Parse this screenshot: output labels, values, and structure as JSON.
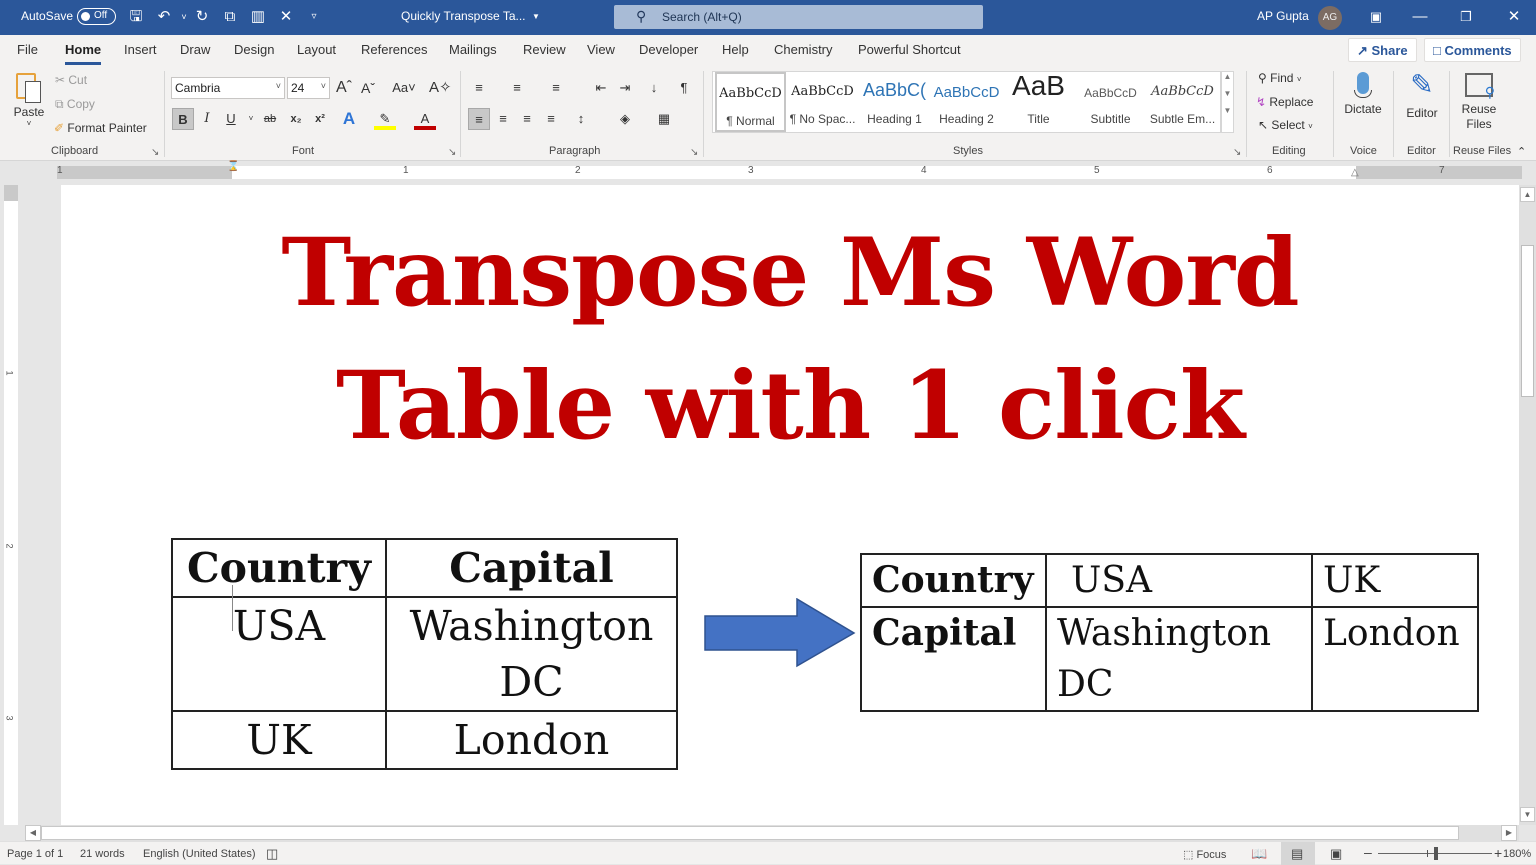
{
  "titlebar": {
    "autosave_label": "AutoSave",
    "autosave_state": "Off",
    "doc_title": "Quickly Transpose Ta...",
    "search_placeholder": "Search (Alt+Q)",
    "user_name": "AP Gupta",
    "user_initials": "AG",
    "quick_access": [
      "save-icon",
      "undo-icon",
      "redo-icon",
      "copy-format-icon",
      "org-chart-icon",
      "close-x-icon",
      "customize-icon"
    ]
  },
  "tabs": [
    "File",
    "Home",
    "Insert",
    "Draw",
    "Design",
    "Layout",
    "References",
    "Mailings",
    "Review",
    "View",
    "Developer",
    "Help",
    "Chemistry",
    "Powerful Shortcut"
  ],
  "active_tab": "Home",
  "header_buttons": {
    "share": "Share",
    "comments": "Comments"
  },
  "ribbon": {
    "clipboard": {
      "label": "Clipboard",
      "paste": "Paste",
      "cut": "Cut",
      "copy": "Copy",
      "format_painter": "Format Painter"
    },
    "font": {
      "label": "Font",
      "font_name": "Cambria",
      "font_size": "24"
    },
    "paragraph": {
      "label": "Paragraph"
    },
    "styles": {
      "label": "Styles",
      "items": [
        {
          "preview": "AaBbCcD",
          "name": "¶ Normal"
        },
        {
          "preview": "AaBbCcD",
          "name": "¶ No Spac..."
        },
        {
          "preview": "AaBbC(",
          "name": "Heading 1"
        },
        {
          "preview": "AaBbCcD",
          "name": "Heading 2"
        },
        {
          "preview": "AaB",
          "name": "Title"
        },
        {
          "preview": "AaBbCcD",
          "name": "Subtitle"
        },
        {
          "preview": "AaBbCcD",
          "name": "Subtle Em..."
        }
      ]
    },
    "editing": {
      "label": "Editing",
      "find": "Find",
      "replace": "Replace",
      "select": "Select"
    },
    "voice": {
      "label": "Voice",
      "dictate": "Dictate"
    },
    "editor": {
      "label": "Editor",
      "editor": "Editor"
    },
    "reuse": {
      "label": "Reuse Files",
      "button_line1": "Reuse",
      "button_line2": "Files"
    }
  },
  "ruler": {
    "h_numbers": [
      "1",
      "1",
      "2",
      "3",
      "4",
      "5",
      "6",
      "7"
    ],
    "v_numbers": [
      "1",
      "2",
      "3"
    ]
  },
  "document": {
    "title_line1": "Transpose Ms Word",
    "title_line2": "Table with 1 click",
    "original_table": {
      "headers": [
        "Country",
        "Capital"
      ],
      "rows": [
        [
          "USA",
          "Washington DC"
        ],
        [
          "UK",
          "London"
        ]
      ]
    },
    "transposed_table": {
      "rows": [
        [
          "Country",
          "USA",
          "UK"
        ],
        [
          "Capital",
          "Washington DC",
          "London"
        ]
      ]
    },
    "arrow_color": "#4472c4",
    "title_color": "#c00000"
  },
  "statusbar": {
    "page": "Page 1 of 1",
    "words": "21 words",
    "language": "English (United States)",
    "focus": "Focus",
    "zoom": "180%"
  }
}
